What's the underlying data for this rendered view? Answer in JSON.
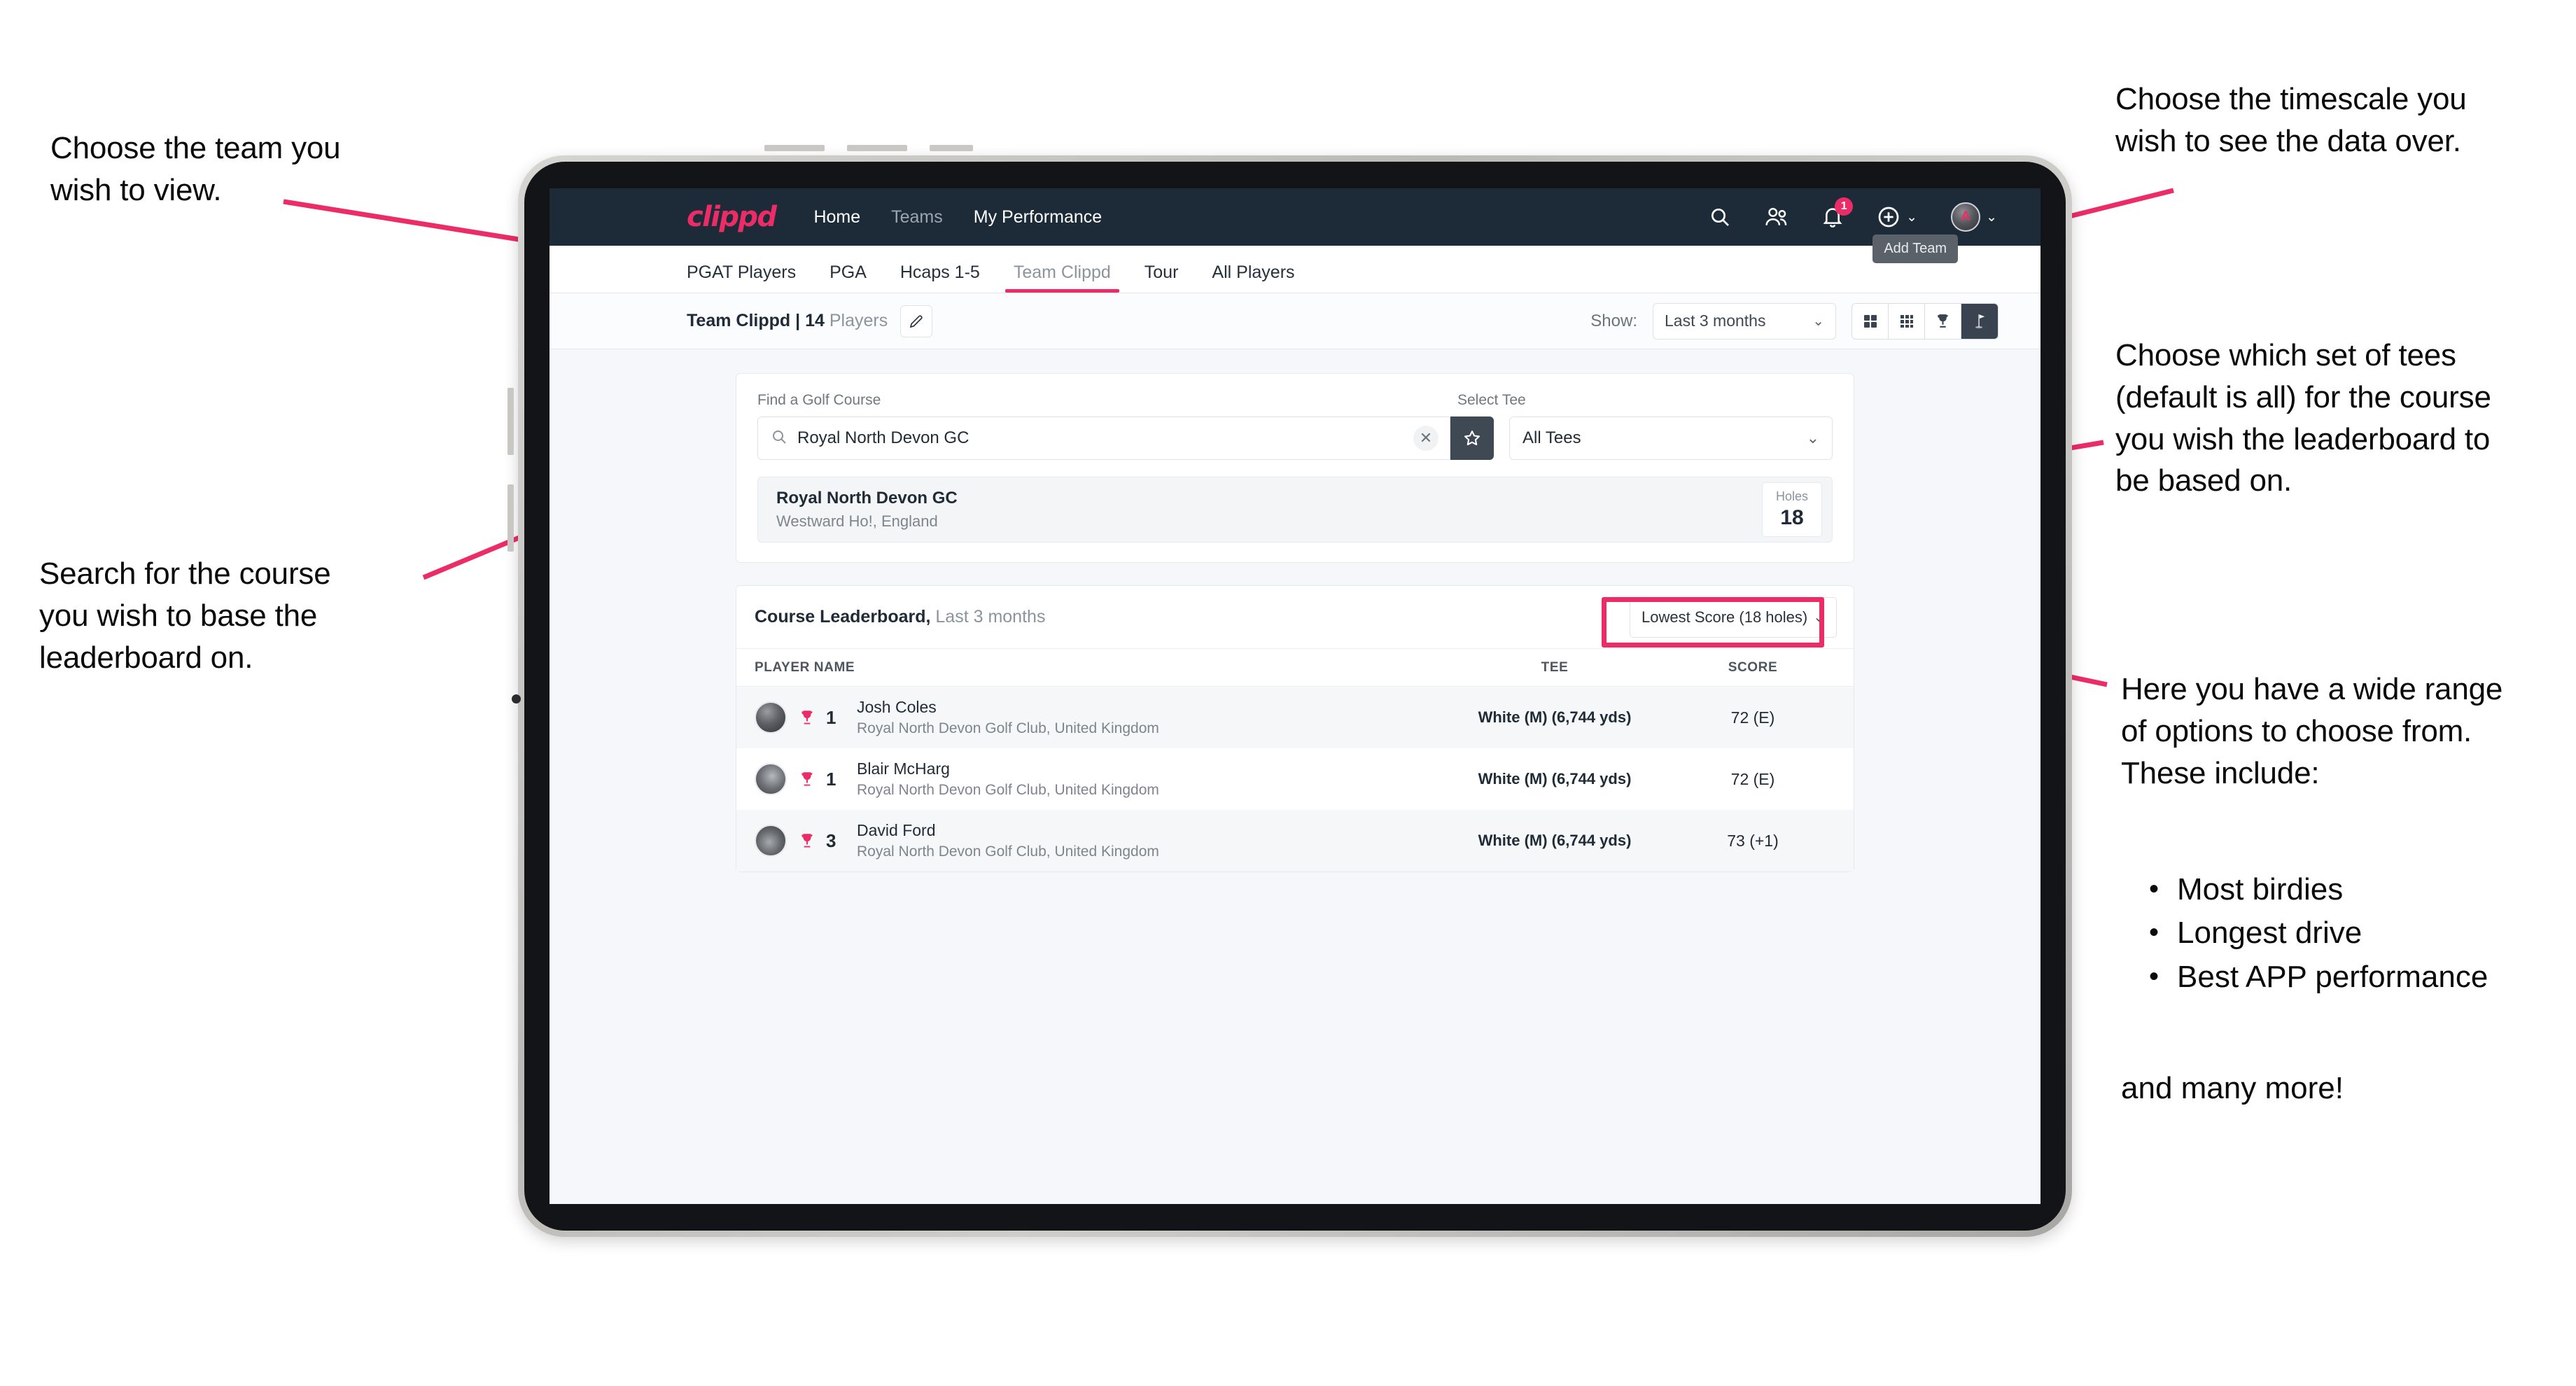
{
  "annotations": {
    "top_left": "Choose the team you\nwish to view.",
    "bottom_left": "Search for the course\nyou wish to base the\nleaderboard on.",
    "top_right": "Choose the timescale you\nwish to see the data over.",
    "mid_right": "Choose which set of tees\n(default is all) for the course\nyou wish the leaderboard to\nbe based on.",
    "bottom_right_intro": "Here you have a wide range\nof options to choose from.\nThese include:",
    "bullets": [
      "Most birdies",
      "Longest drive",
      "Best APP performance"
    ],
    "bottom_right_outro": "and many more!"
  },
  "navbar": {
    "brand": "clippd",
    "links": [
      {
        "label": "Home",
        "dim": false
      },
      {
        "label": "Teams",
        "dim": true
      },
      {
        "label": "My Performance",
        "dim": false
      }
    ],
    "icons": {
      "search": "search-icon",
      "people": "people-icon",
      "bell": "bell-icon",
      "bell_badge": "1",
      "add": "plus-circle-icon",
      "profile": "avatar-icon",
      "avatar_mark": "A"
    }
  },
  "tabs": [
    {
      "label": "PGAT Players",
      "active": false,
      "dim": false
    },
    {
      "label": "PGA",
      "active": false,
      "dim": false
    },
    {
      "label": "Hcaps 1-5",
      "active": false,
      "dim": false
    },
    {
      "label": "Team Clippd",
      "active": true,
      "dim": true
    },
    {
      "label": "Tour",
      "active": false,
      "dim": false
    },
    {
      "label": "All Players",
      "active": false,
      "dim": false
    }
  ],
  "tooltip": {
    "label": "Add Team"
  },
  "toolbar": {
    "team_name": "Team Clippd",
    "separator": "|",
    "player_count": "14",
    "players_word": "Players",
    "edit_icon": "pencil-icon",
    "show_label": "Show:",
    "show_value": "Last 3 months",
    "view_modes": [
      {
        "name": "grid-2x2-icon",
        "active": false
      },
      {
        "name": "grid-3x3-icon",
        "active": false
      },
      {
        "name": "trophy-icon",
        "active": false
      },
      {
        "name": "golf-flag-icon",
        "active": true
      }
    ]
  },
  "search": {
    "course_label": "Find a Golf Course",
    "course_value": "Royal North Devon GC",
    "course_placeholder": "Find a Golf Course",
    "clear_icon": "close-icon",
    "star_icon": "star-icon",
    "tee_label": "Select Tee",
    "tee_value": "All Tees"
  },
  "course_result": {
    "name": "Royal North Devon GC",
    "location": "Westward Ho!, England",
    "holes_label": "Holes",
    "holes_value": "18"
  },
  "leaderboard": {
    "title": "Course Leaderboard,",
    "subtitle": "Last 3 months",
    "sort_value": "Lowest Score (18 holes)",
    "columns": [
      "PLAYER NAME",
      "TEE",
      "SCORE"
    ],
    "rows": [
      {
        "rank": "1",
        "name": "Josh Coles",
        "club": "Royal North Devon Golf Club, United Kingdom",
        "tee": "White (M) (6,744 yds)",
        "score": "72 (E)"
      },
      {
        "rank": "1",
        "name": "Blair McHarg",
        "club": "Royal North Devon Golf Club, United Kingdom",
        "tee": "White (M) (6,744 yds)",
        "score": "72 (E)"
      },
      {
        "rank": "3",
        "name": "David Ford",
        "club": "Royal North Devon Golf Club, United Kingdom",
        "tee": "White (M) (6,744 yds)",
        "score": "73 (+1)"
      }
    ]
  },
  "colors": {
    "accent_pink": "#ec2c67",
    "navbar_dark": "#1d2b38",
    "screen_bg": "#f5f7fa",
    "active_segment": "#3a4450"
  }
}
